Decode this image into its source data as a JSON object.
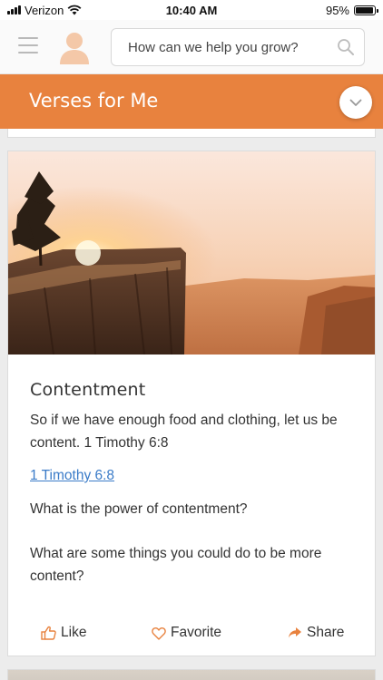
{
  "status_bar": {
    "carrier": "Verizon",
    "time": "10:40 AM",
    "battery_percent": "95%",
    "battery_level": 0.95
  },
  "header": {
    "menu_icon": "hamburger-menu-icon",
    "avatar_icon": "user-avatar-icon",
    "search": {
      "placeholder": "How can we help you grow?",
      "value": "",
      "icon": "search-icon"
    }
  },
  "title_bar": {
    "title": "Verses for Me",
    "background": "#e8823e",
    "dropdown_icon": "chevron-down-icon"
  },
  "card": {
    "image_description_icon": "cliff-sunset-image",
    "title": "Contentment",
    "verse_text": "So if we have enough food and clothing, let us be content. 1 Timothy 6:8",
    "reference_link": "1 Timothy 6:8",
    "question_1": "What is the power of contentment?",
    "question_2": "What are some things you could do to be more content?",
    "actions": {
      "like": "Like",
      "favorite": "Favorite",
      "share": "Share"
    },
    "accent_color": "#e8823e",
    "link_color": "#3a7bc8"
  }
}
